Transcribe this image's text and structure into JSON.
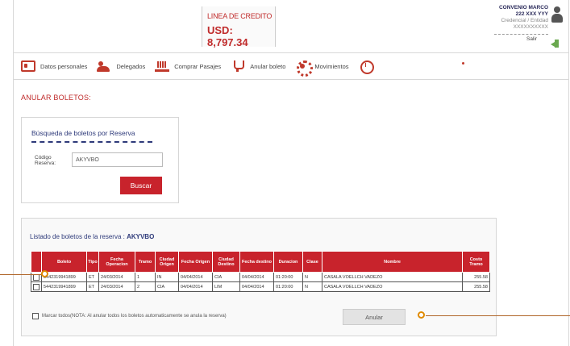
{
  "header": {
    "credit_label": "LINEA DE CREDITO",
    "credit_value": "USD: 8,797.34",
    "user_name": "CONVENIO MARCO",
    "user_code": "222 XXX YYY",
    "user_line2": "Credencial / Entidad",
    "user_line3": "XXXXXXXXXX",
    "logout_label": "Salir"
  },
  "nav": {
    "items": [
      {
        "label": "Datos personales",
        "icon": "id-card-icon"
      },
      {
        "label": "Delegados",
        "icon": "people-icon"
      },
      {
        "label": "Comprar Pasajes",
        "icon": "cart-icon"
      },
      {
        "label": "Anular boleto",
        "icon": "cup-icon"
      },
      {
        "label": "Movimientos",
        "icon": "gear-icon"
      },
      {
        "label": "",
        "icon": "clock-icon"
      }
    ]
  },
  "page_title": "ANULAR BOLETOS:",
  "search": {
    "title": "Búsqueda de boletos por Reserva",
    "code_label": "Código Reserva:",
    "code_value": "AKYVBO",
    "button_label": "Buscar"
  },
  "results": {
    "title_prefix": "Listado de boletos de la reserva : ",
    "pnr": "AKYVBO",
    "columns": [
      "",
      "Boleto",
      "Tipo",
      "Fecha Operacion",
      "Tramo",
      "Ciudad Origen",
      "Fecha Origen",
      "Ciudad Destino",
      "Fecha destino",
      "Duracion",
      "Clase",
      "Nombre",
      "Costo Tramo"
    ],
    "rows": [
      [
        "",
        "5442319941899",
        "ET",
        "24/03/2014",
        "1",
        "IN",
        "04/04/2014",
        "CIA",
        "04/04/2014",
        "01:20:00",
        "N",
        "CASALA VOELLCH VADEZO",
        "255.58"
      ],
      [
        "",
        "5442319941899",
        "ET",
        "24/03/2014",
        "2",
        "CIA",
        "04/04/2014",
        "LIM",
        "04/04/2014",
        "01:20:00",
        "N",
        "CASALA VOELLCH VADEZO",
        "255.58"
      ]
    ],
    "select_all_label": "Marcar todos(NOTA: Al anular todos los boletos automaticamente se anula la reserva)",
    "annul_button": "Anular"
  },
  "colors": {
    "accent_red": "#c8232c",
    "title_blue": "#2e3a7a",
    "annotation_orange": "#e08a00"
  }
}
